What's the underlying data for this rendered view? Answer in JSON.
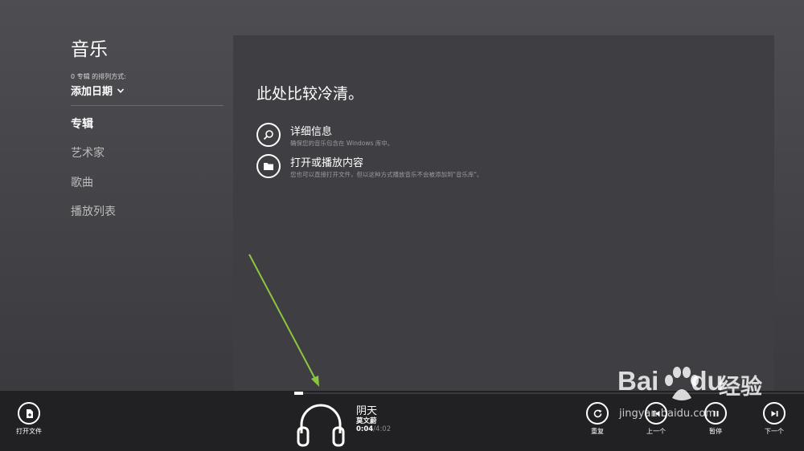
{
  "app": {
    "title": "音乐"
  },
  "sort": {
    "label": "0 专辑 的排列方式:",
    "value": "添加日期"
  },
  "nav": {
    "items": [
      {
        "label": "专辑",
        "active": true
      },
      {
        "label": "艺术家"
      },
      {
        "label": "歌曲"
      },
      {
        "label": "播放列表"
      }
    ]
  },
  "main": {
    "empty_title": "此处比较冷清。",
    "actions": [
      {
        "title": "详细信息",
        "subtitle": "确保您的音乐包含在 Windows 库中。",
        "icon": "search-icon"
      },
      {
        "title": "打开或播放内容",
        "subtitle": "您也可以直接打开文件，但以这种方式播放音乐不会被添加到\"音乐库\"。",
        "icon": "folder-icon"
      }
    ]
  },
  "player": {
    "open_file_label": "打开文件",
    "track_title": "阴天",
    "artist": "莫文蔚",
    "time_current": "0:04",
    "time_separator": "/",
    "time_total": "4:02",
    "progress": 0.0166,
    "album_icon": "headphones-icon",
    "controls": [
      {
        "label": "重复",
        "icon": "repeat-icon"
      },
      {
        "label": "上一个",
        "icon": "previous-icon"
      },
      {
        "label": "暂停",
        "icon": "pause-icon"
      },
      {
        "label": "下一个",
        "icon": "next-icon"
      }
    ]
  },
  "watermark": {
    "logo_text": "Bai",
    "logo_text_2": "du",
    "cn_text": "经验",
    "url": "jingyan.baidu.com"
  },
  "colors": {
    "background": "#44444a",
    "panel": "#3f3f43",
    "player_bar": "#212123",
    "annotation_arrow": "#8cc63f",
    "secondary_text": "#9a9a9e"
  }
}
